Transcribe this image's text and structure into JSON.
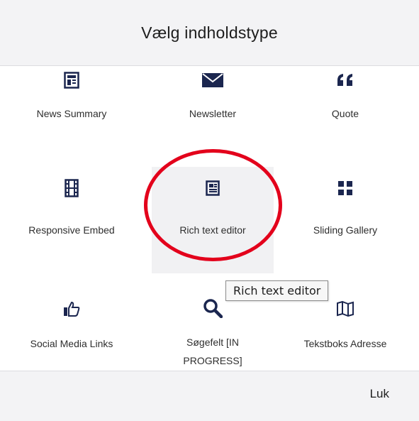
{
  "dialog": {
    "title": "Vælg indholdstype",
    "close_label": "Luk"
  },
  "tiles": [
    {
      "label": "News Summary",
      "icon": "news-summary-icon"
    },
    {
      "label": "Newsletter",
      "icon": "envelope-icon"
    },
    {
      "label": "Quote",
      "icon": "quote-icon"
    },
    {
      "label": "Responsive Embed",
      "icon": "film-icon"
    },
    {
      "label": "Rich text editor",
      "icon": "rich-text-icon"
    },
    {
      "label": "Sliding Gallery",
      "icon": "grid-icon"
    },
    {
      "label": "Social Media Links",
      "icon": "thumbs-up-icon"
    },
    {
      "label": "Søgefelt [IN PROGRESS]",
      "icon": "search-icon"
    },
    {
      "label": "Tekstboks Adresse",
      "icon": "map-icon"
    }
  ],
  "tooltip": {
    "text": "Rich text editor"
  },
  "colors": {
    "highlight_circle": "#e3001b",
    "icon": "#1b264f",
    "panel_bg": "#f3f3f5"
  }
}
